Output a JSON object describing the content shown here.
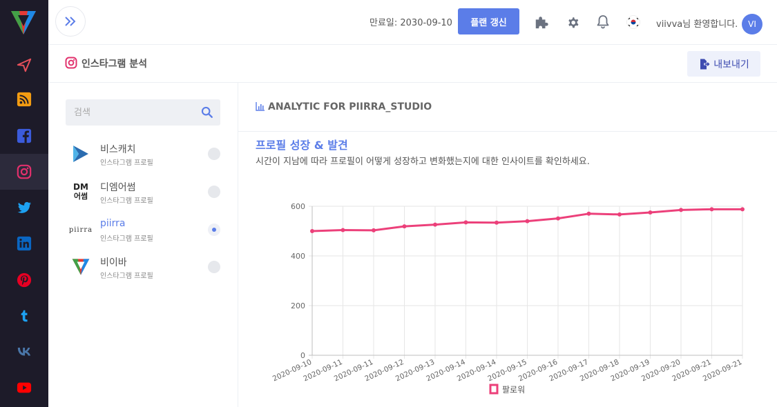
{
  "header": {
    "expiry": "만료일: 2030-09-10",
    "renew_label": "플랜 갱신",
    "welcome": "viivva님 환영합니다.",
    "avatar_initials": "VI",
    "flag": "KR"
  },
  "sidebar": {
    "items": [
      {
        "name": "send",
        "icon": "paper-plane-icon",
        "color": "#e8505b"
      },
      {
        "name": "rss",
        "icon": "rss-icon",
        "color": "#f39c12"
      },
      {
        "name": "facebook",
        "icon": "facebook-icon",
        "color": "#3b5bdb"
      },
      {
        "name": "instagram",
        "icon": "instagram-icon",
        "color": "#e1306c",
        "active": true
      },
      {
        "name": "twitter",
        "icon": "twitter-icon",
        "color": "#1da1f2"
      },
      {
        "name": "linkedin",
        "icon": "linkedin-icon",
        "color": "#0a66c2"
      },
      {
        "name": "pinterest",
        "icon": "pinterest-icon",
        "color": "#e60023"
      },
      {
        "name": "tumblr",
        "icon": "tumblr-icon",
        "color": "#1da1f2"
      },
      {
        "name": "vk",
        "icon": "vk-icon",
        "color": "#4a76a8"
      },
      {
        "name": "youtube",
        "icon": "youtube-icon",
        "color": "#ff0000"
      }
    ]
  },
  "subheader": {
    "title": "인스타그램 분석",
    "export_label": "내보내기"
  },
  "profiles": {
    "search_placeholder": "검색",
    "items": [
      {
        "name": "비스캐치",
        "subtitle": "인스타그램 프로필",
        "selected": false,
        "logo_text": ""
      },
      {
        "name": "디엠어썸",
        "subtitle": "인스타그램 프로필",
        "selected": false,
        "logo_text": "DM\n어썸"
      },
      {
        "name": "piirra",
        "subtitle": "인스타그램 프로필",
        "selected": true,
        "logo_text": "piirra"
      },
      {
        "name": "비이바",
        "subtitle": "인스타그램 프로필",
        "selected": false,
        "logo_text": ""
      }
    ]
  },
  "analytics": {
    "header": "ANALYTIC FOR PIIRRA_STUDIO",
    "section_title": "프로필 성장 & 발견",
    "section_desc": "시간이 지남에 따라 프로필이 어떻게 성장하고 변화했는지에 대한 인사이트를 확인하세요."
  },
  "chart_data": {
    "type": "line",
    "x": [
      "2020-09-10",
      "2020-09-11",
      "2020-09-11",
      "2020-09-12",
      "2020-09-13",
      "2020-09-14",
      "2020-09-14",
      "2020-09-15",
      "2020-09-16",
      "2020-09-17",
      "2020-09-18",
      "2020-09-19",
      "2020-09-20",
      "2020-09-21",
      "2020-09-21"
    ],
    "series": [
      {
        "name": "팔로워",
        "color": "#ec407a",
        "values": [
          500,
          504,
          503,
          519,
          526,
          535,
          534,
          540,
          551,
          570,
          567,
          575,
          585,
          588,
          588
        ]
      }
    ],
    "ylim": [
      0,
      600
    ],
    "yticks": [
      "0",
      "200",
      "400",
      "600"
    ],
    "grid": true,
    "legend": "bottom"
  }
}
